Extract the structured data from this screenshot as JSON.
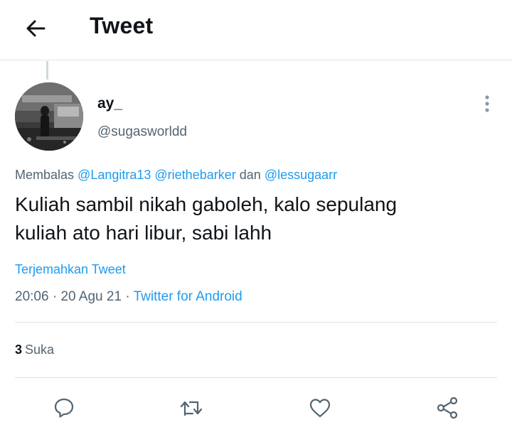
{
  "header": {
    "back_icon": "arrow-left-icon",
    "title": "Tweet"
  },
  "author": {
    "display_name": "ay_",
    "handle": "@sugasworldd",
    "more_icon": "more-vertical-icon"
  },
  "reply": {
    "prefix": "Membalas",
    "mention_1": "@Langitra13",
    "mention_2": "@riethebarker",
    "conjunction": "dan",
    "mention_3": "@lessugaarr"
  },
  "tweet": {
    "line_1": "Kuliah sambil nikah gaboleh, kalo sepulang",
    "line_2": "kuliah ato hari libur, sabi lahh",
    "translate": "Terjemahkan Tweet",
    "time": "20:06",
    "date": "20 Agu 21",
    "separator": "·",
    "source": "Twitter for Android"
  },
  "stats": {
    "likes_count": "3",
    "likes_label": "Suka"
  },
  "actions": {
    "reply_icon": "reply-bubble-icon",
    "retweet_icon": "retweet-icon",
    "like_icon": "heart-icon",
    "share_icon": "share-icon"
  },
  "colors": {
    "accent": "#1d9bf0",
    "secondary_text": "#536471",
    "divider": "#dfe3e6"
  }
}
